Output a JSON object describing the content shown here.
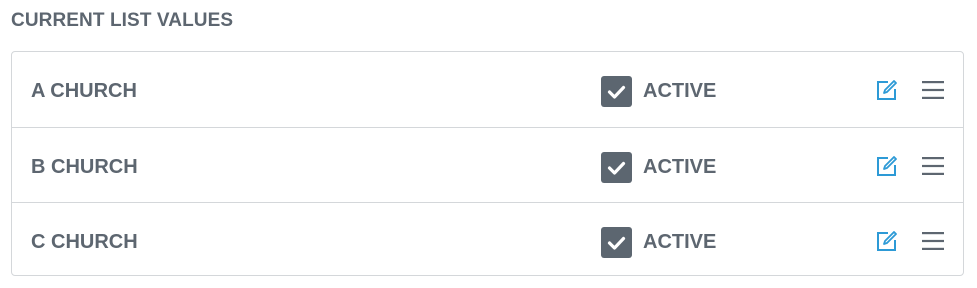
{
  "section": {
    "title": "CURRENT LIST VALUES"
  },
  "list": {
    "rows": [
      {
        "name": "A CHURCH",
        "status_label": "ACTIVE",
        "active": true
      },
      {
        "name": "B CHURCH",
        "status_label": "ACTIVE",
        "active": true
      },
      {
        "name": "C CHURCH",
        "status_label": "ACTIVE",
        "active": true
      }
    ]
  },
  "colors": {
    "text": "#5d6670",
    "checkbox_fill": "#5c6670",
    "edit_icon": "#2d9ad6",
    "drag_icon": "#5d6670",
    "border": "#d4d7da"
  },
  "icons": {
    "checkbox": "checkmark-icon",
    "edit": "edit-icon",
    "drag": "drag-handle-icon"
  }
}
